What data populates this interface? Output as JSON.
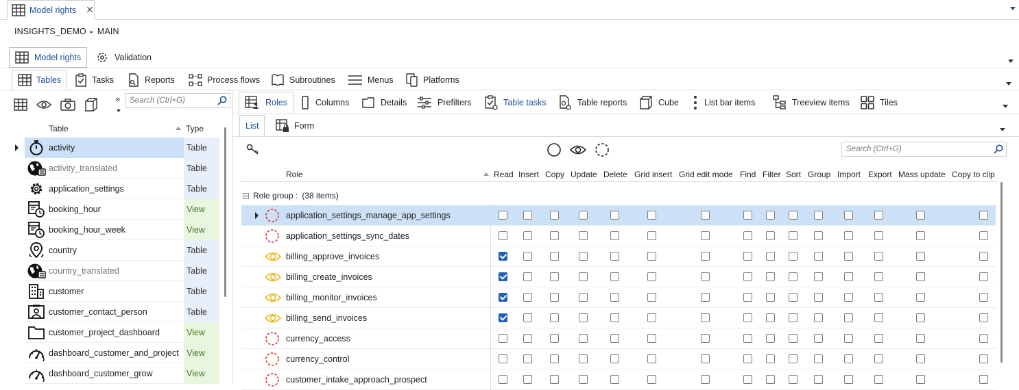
{
  "doc_tab": {
    "label": "Model rights",
    "close": "✕"
  },
  "breadcrumb": {
    "part1": "INSIGHTS_DEMO",
    "sep": "▸",
    "part2": "MAIN"
  },
  "module_tabs": [
    {
      "label": "Model rights",
      "icon": "grid-icon"
    },
    {
      "label": "Validation",
      "icon": "gear-check-icon"
    }
  ],
  "sub_tabs": [
    {
      "label": "Tables",
      "icon": "grid-icon"
    },
    {
      "label": "Tasks",
      "icon": "clipboard-check-icon"
    },
    {
      "label": "Reports",
      "icon": "report-icon"
    },
    {
      "label": "Process flows",
      "icon": "process-flow-icon"
    },
    {
      "label": "Subroutines",
      "icon": "book-icon"
    },
    {
      "label": "Menus",
      "icon": "menu-icon"
    },
    {
      "label": "Platforms",
      "icon": "platforms-icon"
    }
  ],
  "left_panel": {
    "search_placeholder": "Search (Ctrl+G)",
    "overflow": "»",
    "columns": {
      "table": "Table",
      "type": "Type"
    },
    "rows": [
      {
        "name": "activity",
        "type": "Table",
        "icon": "stopwatch-icon",
        "gray": false
      },
      {
        "name": "activity_translated",
        "type": "Table",
        "icon": "globe-icon",
        "gray": true
      },
      {
        "name": "application_settings",
        "type": "Table",
        "icon": "gear-icon",
        "gray": false
      },
      {
        "name": "booking_hour",
        "type": "View",
        "icon": "calendar-clock-icon",
        "gray": false
      },
      {
        "name": "booking_hour_week",
        "type": "View",
        "icon": "calendar-clock-icon",
        "gray": false
      },
      {
        "name": "country",
        "type": "Table",
        "icon": "map-pin-icon",
        "gray": false
      },
      {
        "name": "country_translated",
        "type": "Table",
        "icon": "globe-icon",
        "gray": true
      },
      {
        "name": "customer",
        "type": "Table",
        "icon": "building-icon",
        "gray": false
      },
      {
        "name": "customer_contact_person",
        "type": "Table",
        "icon": "contact-card-icon",
        "gray": false
      },
      {
        "name": "customer_project_dashboard",
        "type": "View",
        "icon": "folder-icon",
        "gray": false
      },
      {
        "name": "dashboard_customer_and_project",
        "type": "View",
        "icon": "gauge-icon",
        "gray": false
      },
      {
        "name": "dashboard_customer_grow",
        "type": "View",
        "icon": "gauge-icon",
        "gray": false
      }
    ]
  },
  "right_tabs": [
    {
      "label": "Roles",
      "icon": "grid-user-icon"
    },
    {
      "label": "Columns",
      "icon": "column-icon"
    },
    {
      "label": "Details",
      "icon": "details-icon"
    },
    {
      "label": "Prefilters",
      "icon": "sliders-icon"
    },
    {
      "label": "Table tasks",
      "icon": "clipboard-check-icon"
    },
    {
      "label": "Table reports",
      "icon": "report-icon"
    },
    {
      "label": "Cube",
      "icon": "cube-icon"
    },
    {
      "label": "List bar items",
      "icon": "vertical-dots-icon"
    },
    {
      "label": "Treeview items",
      "icon": "tree-icon"
    },
    {
      "label": "Tiles",
      "icon": "tiles-icon"
    }
  ],
  "list_form_tabs": [
    {
      "label": "List"
    },
    {
      "label": "Form",
      "icon": "form-lock-icon"
    }
  ],
  "grid": {
    "search_placeholder": "Search (Ctrl+G)",
    "role_header": "Role",
    "columns": [
      "Read",
      "Insert",
      "Copy",
      "Update",
      "Delete",
      "Grid insert",
      "Grid edit mode",
      "Find",
      "Filter",
      "Sort",
      "Group",
      "Import",
      "Export",
      "Mass update",
      "Copy to clip"
    ],
    "group_label": "Role group :",
    "group_count": "(38 items)",
    "rows": [
      {
        "name": "application_settings_manage_app_settings",
        "icon": "dashed-circle-icon",
        "read": false
      },
      {
        "name": "application_settings_sync_dates",
        "icon": "dashed-circle-icon",
        "read": false
      },
      {
        "name": "billing_approve_invoices",
        "icon": "eye-icon",
        "read": true
      },
      {
        "name": "billing_create_invoices",
        "icon": "eye-icon",
        "read": true
      },
      {
        "name": "billing_monitor_invoices",
        "icon": "eye-icon",
        "read": true
      },
      {
        "name": "billing_send_invoices",
        "icon": "eye-icon",
        "read": true
      },
      {
        "name": "currency_access",
        "icon": "dashed-circle-icon",
        "read": false
      },
      {
        "name": "currency_control",
        "icon": "dashed-circle-icon",
        "read": false
      },
      {
        "name": "customer_intake_approach_prospect",
        "icon": "dashed-circle-icon",
        "read": false
      }
    ]
  },
  "colors": {
    "accent": "#1a4f9c",
    "selection": "#cce1f7",
    "type_table_bg": "#e8effb",
    "type_view_bg": "#eaf5df",
    "dashed_red": "#d9342b",
    "eye_yellow": "#e8b923",
    "checkbox_blue": "#1e62b8"
  }
}
